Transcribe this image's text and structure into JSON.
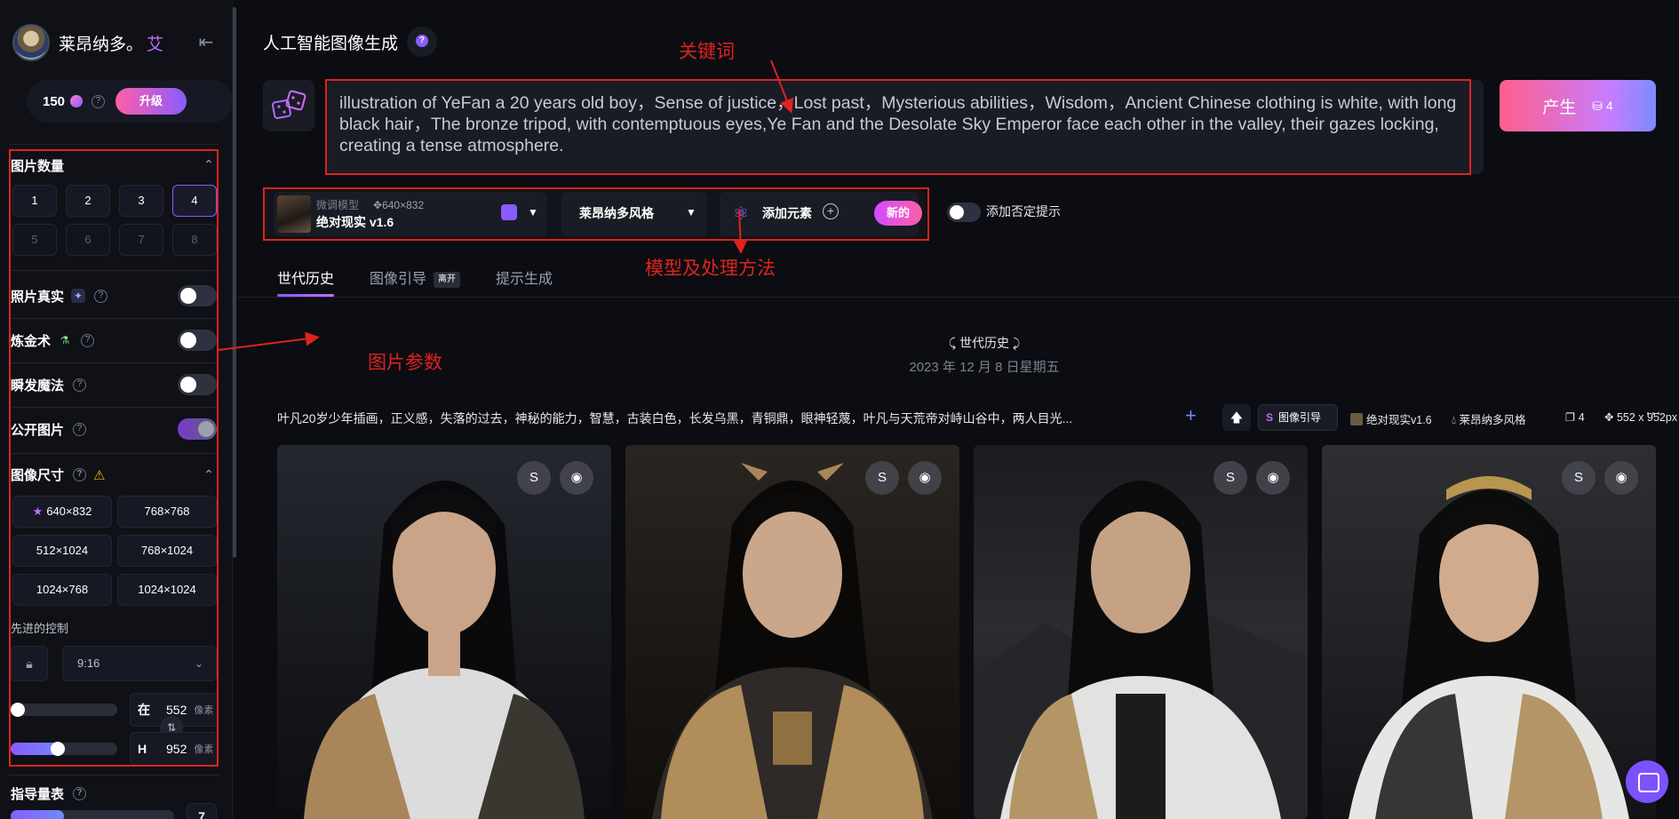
{
  "user": {
    "name": "莱昂纳多。",
    "suffix": "艾"
  },
  "credits": {
    "value": "150",
    "upgrade_label": "升级"
  },
  "image_count": {
    "title": "图片数量",
    "options": [
      "1",
      "2",
      "3",
      "4",
      "5",
      "6",
      "7",
      "8"
    ],
    "selected": "4"
  },
  "toggles": {
    "photo_real": "照片真实",
    "alchemy": "炼金术",
    "instant_magic": "瞬发魔法",
    "public_images": "公开图片"
  },
  "image_size": {
    "title": "图像尺寸",
    "options": [
      "640×832",
      "768×768",
      "512×1024",
      "768×1024",
      "1024×768",
      "1024×1024"
    ]
  },
  "advanced": {
    "title": "先进的控制",
    "ratio": "9:16",
    "width_key": "在",
    "width_value": "552",
    "height_key": "H",
    "height_value": "952",
    "unit": "像素",
    "width_level_fraction": 0.0,
    "height_level_fraction": 0.43
  },
  "guidance": {
    "title": "指导量表",
    "value": "7",
    "level_fraction": 0.33
  },
  "header": {
    "title": "人工智能图像生成"
  },
  "prompt": {
    "text": "illustration of YeFan a 20 years old boy，Sense of justice，Lost past，Mysterious abilities，Wisdom，Ancient Chinese clothing is white, with long black hair，The bronze tripod, with contemptuous eyes,Ye Fan and the Desolate Sky Emperor face each other in the valley, their gazes locking, creating a tense atmosphere."
  },
  "generate": {
    "label": "产生",
    "cost": "4"
  },
  "model": {
    "sub_label": "微调模型",
    "dims": "640×832",
    "name": "绝对现实 v1.6",
    "style": "莱昂纳多风格",
    "add_element": "添加元素",
    "new_badge": "新的"
  },
  "negative_prompt_label": "添加否定提示",
  "tabs": [
    {
      "label": "世代历史"
    },
    {
      "label": "图像引导",
      "badge": "离开"
    },
    {
      "label": "提示生成"
    }
  ],
  "history": {
    "title": "世代历史",
    "date": "2023 年 12 月 8 日星期五"
  },
  "generation": {
    "prompt": "叶凡20岁少年插画，正义感，失落的过去，神秘的能力，智慧，古装白色，长发乌黑，青铜鼎，眼神轻蔑，叶凡与天荒帝对峙山谷中，两人目光...",
    "guide_label": "图像引导",
    "model": "绝对现实v1.6",
    "style": "莱昂纳多风格",
    "count": "4",
    "size": "552 x 952px"
  },
  "annotations": {
    "keywords": "关键词",
    "model_method": "模型及处理方法",
    "image_params": "图片参数"
  },
  "colors": {
    "accent": "#8a5bff",
    "annotation": "#e0221f",
    "background": "#0b0d12"
  }
}
